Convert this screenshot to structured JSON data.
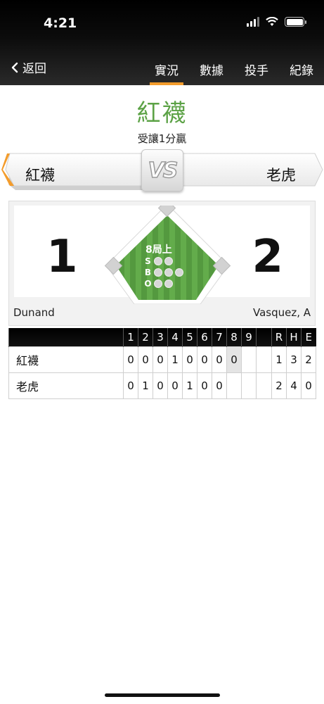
{
  "status": {
    "time": "4:21"
  },
  "nav": {
    "back_label": "返回",
    "tabs": [
      {
        "label": "實況",
        "active": true
      },
      {
        "label": "數據",
        "active": false
      },
      {
        "label": "投手",
        "active": false
      },
      {
        "label": "紀錄",
        "active": false
      }
    ]
  },
  "handicap": {
    "team": "紅襪",
    "desc": "受讓1分贏"
  },
  "matchup": {
    "vs": "VS",
    "away": "紅襪",
    "home": "老虎"
  },
  "score": {
    "away": "1",
    "home": "2",
    "inning": "8局上",
    "strikes": 2,
    "balls": 3,
    "outs": 2,
    "away_pitcher": "Dunand",
    "home_pitcher": "Vasquez, A"
  },
  "linescore": {
    "headers": [
      "",
      "1",
      "2",
      "3",
      "4",
      "5",
      "6",
      "7",
      "8",
      "9",
      "",
      "R",
      "H",
      "E"
    ],
    "rows": [
      {
        "team": "紅襪",
        "innings": [
          "0",
          "0",
          "0",
          "1",
          "0",
          "0",
          "0",
          "0",
          "",
          ""
        ],
        "R": "1",
        "H": "3",
        "E": "2"
      },
      {
        "team": "老虎",
        "innings": [
          "0",
          "1",
          "0",
          "0",
          "1",
          "0",
          "0",
          "",
          "",
          ""
        ],
        "R": "2",
        "H": "4",
        "E": "0"
      }
    ]
  },
  "colors": {
    "accent": "#f39c2c",
    "field": "#5ca246",
    "handicap_text": "#5ca246"
  }
}
